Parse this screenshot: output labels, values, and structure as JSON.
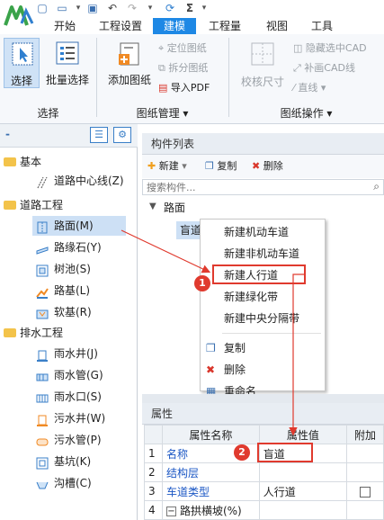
{
  "ribbon_tabs": [
    "开始",
    "工程设置",
    "建模",
    "工程量",
    "视图",
    "工具"
  ],
  "ribbon": {
    "select": "选择",
    "batch_select": "批量选择",
    "add_drawing": "添加图纸",
    "locate_drawing": "定位图纸",
    "split_drawing": "拆分图纸",
    "import_pdf": "导入PDF",
    "check_size": "校核尺寸",
    "hide_cad": "隐藏选中CAD",
    "draw_cad_line": "补画CAD线",
    "straight_line": "直线",
    "group_select": "选择",
    "group_drawing_mgmt": "图纸管理",
    "group_drawing_ops": "图纸操作"
  },
  "tree": {
    "categories": [
      {
        "label": "基本",
        "items": [
          "道路中心线(Z)"
        ]
      },
      {
        "label": "道路工程",
        "items": [
          "路面(M)",
          "路缘石(Y)",
          "树池(S)",
          "路基(L)",
          "软基(R)"
        ]
      },
      {
        "label": "排水工程",
        "items": [
          "雨水井(J)",
          "雨水管(G)",
          "雨水口(S)",
          "污水井(W)",
          "污水管(P)",
          "基坑(K)",
          "沟槽(C)"
        ]
      }
    ]
  },
  "component_list": {
    "title": "构件列表",
    "new_label": "新建",
    "copy_label": "复制",
    "delete_label": "删除",
    "search_placeholder": "搜索构件...",
    "group": "路面",
    "selected_item": "盲道"
  },
  "context_menu": {
    "items": [
      "新建机动车道",
      "新建非机动车道",
      "新建人行道",
      "新建绿化带",
      "新建中央分隔带"
    ],
    "actions": [
      "复制",
      "删除",
      "重命名"
    ]
  },
  "properties": {
    "title": "属性",
    "headers": [
      "属性名称",
      "属性值",
      "附加"
    ],
    "rows": [
      {
        "num": "1",
        "name": "名称",
        "value": "盲道"
      },
      {
        "num": "2",
        "name": "结构层",
        "value": ""
      },
      {
        "num": "3",
        "name": "车道类型",
        "value": "人行道"
      },
      {
        "num": "4",
        "name": "路拱横坡(%)",
        "value": ""
      }
    ]
  },
  "markers": [
    "1",
    "2"
  ],
  "colors": {
    "accent": "#1e88e5",
    "annotation": "#e03a2e",
    "folder": "#f3c34a"
  }
}
